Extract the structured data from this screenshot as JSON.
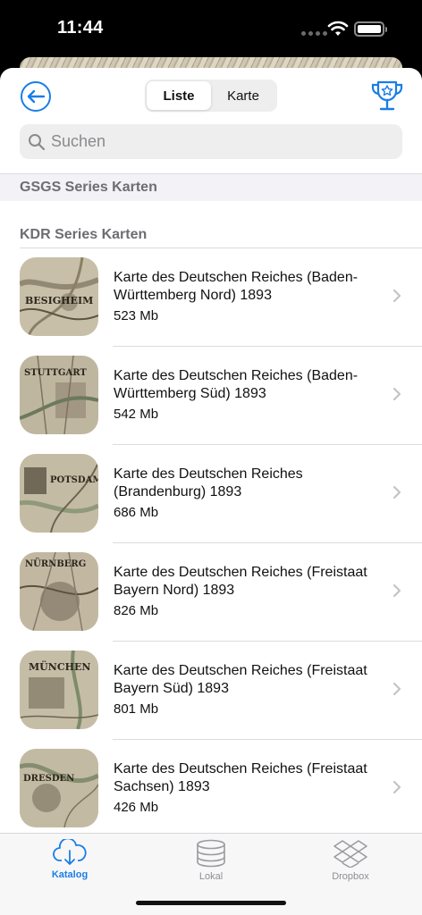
{
  "status_bar": {
    "time": "11:44"
  },
  "header": {
    "segments": [
      {
        "label": "Liste",
        "active": true
      },
      {
        "label": "Karte",
        "active": false
      }
    ]
  },
  "search": {
    "placeholder": "Suchen",
    "value": ""
  },
  "sections": [
    {
      "title": "GSGS Series Karten"
    },
    {
      "title": "KDR Series Karten"
    }
  ],
  "maps": [
    {
      "title": "Karte des Deutschen Reiches (Baden-Württemberg Nord) 1893",
      "size": "523 Mb",
      "thumb_label": "BESIGHEIM"
    },
    {
      "title": "Karte des Deutschen Reiches (Baden-Württemberg Süd) 1893",
      "size": "542 Mb",
      "thumb_label": "STUTTGART"
    },
    {
      "title": "Karte des Deutschen Reiches (Brandenburg) 1893",
      "size": "686 Mb",
      "thumb_label": "POTSDAM"
    },
    {
      "title": "Karte des Deutschen Reiches (Freistaat Bayern Nord) 1893",
      "size": "826 Mb",
      "thumb_label": "NÜRNBERG"
    },
    {
      "title": "Karte des Deutschen Reiches (Freistaat Bayern Süd) 1893",
      "size": "801 Mb",
      "thumb_label": "MÜNCHEN"
    },
    {
      "title": "Karte des Deutschen Reiches (Freistaat Sachsen) 1893",
      "size": "426 Mb",
      "thumb_label": "DRESDEN"
    }
  ],
  "tabbar": {
    "tabs": [
      {
        "label": "Katalog",
        "icon": "cloud-download-icon",
        "active": true
      },
      {
        "label": "Lokal",
        "icon": "database-icon",
        "active": false
      },
      {
        "label": "Dropbox",
        "icon": "dropbox-icon",
        "active": false
      }
    ]
  },
  "colors": {
    "accent": "#1a7ee5",
    "separator": "#dcdcdf",
    "section_bg": "#f2f2f7"
  }
}
